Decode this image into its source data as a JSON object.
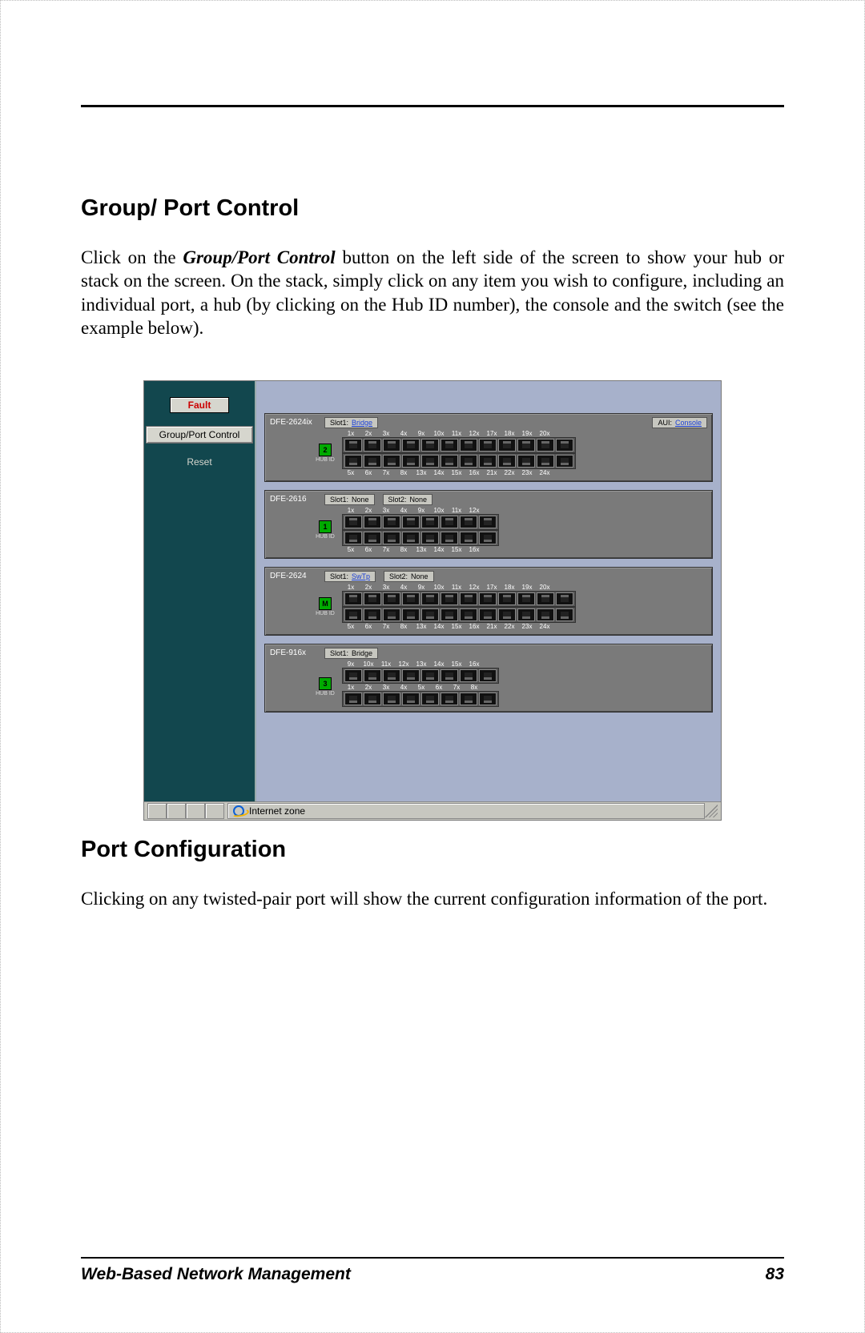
{
  "headings": {
    "h1": "Group/ Port Control",
    "h2": "Port Configuration"
  },
  "paragraphs": {
    "p1_a": "Click on the ",
    "p1_b": "Group/Port Control",
    "p1_c": " button on the left side of the screen to show your hub or stack on the screen.  On the stack, simply click on any item you wish to configure, including an individual port, a hub (by clicking on the Hub ID number), the console and the switch (see the example below).",
    "p2": "Clicking on any twisted-pair port will show the current configuration information of the port."
  },
  "sidebar": {
    "fault": "Fault",
    "group_btn": "Group/Port Control",
    "reset": "Reset"
  },
  "hubs": [
    {
      "name": "DFE-2624ix",
      "hub_id": "2",
      "slots": [
        {
          "label": "Slot1:",
          "value": "Bridge",
          "link": true
        }
      ],
      "aui": {
        "label": "AUI:",
        "value": "Console",
        "link": true
      },
      "top_nums": [
        "1x",
        "2x",
        "3x",
        "4x",
        "9x",
        "10x",
        "11x",
        "12x",
        "17x",
        "18x",
        "19x",
        "20x"
      ],
      "bot_nums": [
        "5x",
        "6x",
        "7x",
        "8x",
        "13x",
        "14x",
        "15x",
        "16x",
        "21x",
        "22x",
        "23x",
        "24x"
      ],
      "port_count": 12
    },
    {
      "name": "DFE-2616",
      "hub_id": "1",
      "slots": [
        {
          "label": "Slot1:",
          "value": "None",
          "link": false
        },
        {
          "label": "Slot2:",
          "value": "None",
          "link": false
        }
      ],
      "top_nums": [
        "1x",
        "2x",
        "3x",
        "4x",
        "9x",
        "10x",
        "11x",
        "12x"
      ],
      "bot_nums": [
        "5x",
        "6x",
        "7x",
        "8x",
        "13x",
        "14x",
        "15x",
        "16x"
      ],
      "port_count": 8
    },
    {
      "name": "DFE-2624",
      "hub_id": "M",
      "slots": [
        {
          "label": "Slot1:",
          "value": "SwTp",
          "link": true
        },
        {
          "label": "Slot2:",
          "value": "None",
          "link": false
        }
      ],
      "top_nums": [
        "1x",
        "2x",
        "3x",
        "4x",
        "9x",
        "10x",
        "11x",
        "12x",
        "17x",
        "18x",
        "19x",
        "20x"
      ],
      "bot_nums": [
        "5x",
        "6x",
        "7x",
        "8x",
        "13x",
        "14x",
        "15x",
        "16x",
        "21x",
        "22x",
        "23x",
        "24x"
      ],
      "port_count": 12
    },
    {
      "name": "DFE-916x",
      "hub_id": "3",
      "slots": [
        {
          "label": "Slot1:",
          "value": "Bridge",
          "link": false
        }
      ],
      "top_nums": [
        "9x",
        "10x",
        "11x",
        "12x",
        "13x",
        "14x",
        "15x",
        "16x"
      ],
      "bot_nums": [
        "1x",
        "2x",
        "3x",
        "4x",
        "5x",
        "6x",
        "7x",
        "8x"
      ],
      "port_count": 8,
      "flipped": true
    }
  ],
  "statusbar": {
    "zone": "Internet zone"
  },
  "labels": {
    "hub_id": "HUB ID"
  },
  "footer": {
    "left": "Web-Based Network Management",
    "right": "83"
  }
}
